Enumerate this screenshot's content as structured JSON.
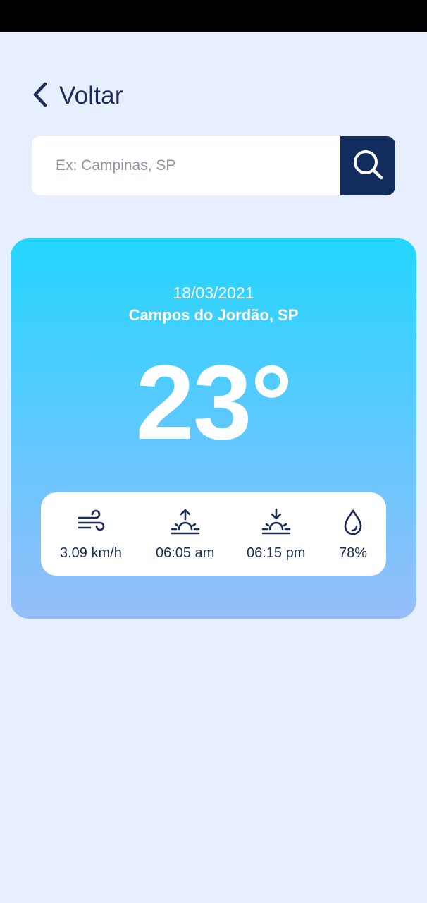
{
  "header": {
    "back_label": "Voltar"
  },
  "search": {
    "placeholder": "Ex: Campinas, SP",
    "value": ""
  },
  "weather": {
    "date": "18/03/2021",
    "city": "Campos do Jordão, SP",
    "temperature": "23°",
    "wind": "3.09 km/h",
    "sunrise": "06:05 am",
    "sunset": "06:15 pm",
    "humidity": "78%"
  },
  "colors": {
    "background": "#E7EEFD",
    "primary": "#122C5E",
    "card_gradient_top": "#23D6FE",
    "card_gradient_bottom": "#96BEFA"
  },
  "icons": [
    "chevron-left-icon",
    "search-icon",
    "wind-icon",
    "sunrise-icon",
    "sunset-icon",
    "humidity-drop-icon"
  ]
}
